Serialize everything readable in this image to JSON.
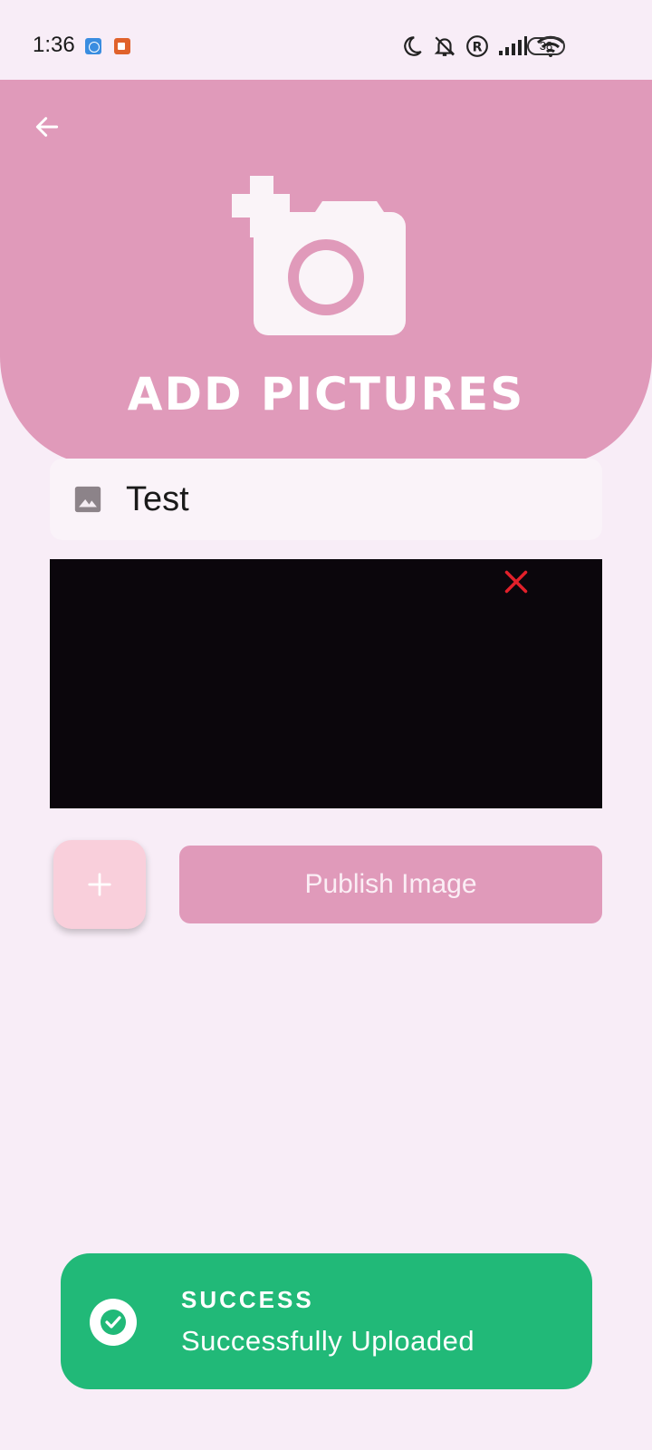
{
  "status_bar": {
    "time": "1:36",
    "battery": "38"
  },
  "header": {
    "title": "ADD PICTURES"
  },
  "form": {
    "title_value": "Test"
  },
  "actions": {
    "add_label": "+",
    "publish_label": "Publish Image"
  },
  "toast": {
    "title": "SUCCESS",
    "message": "Successfully Uploaded"
  },
  "colors": {
    "header": "#e09aba",
    "background": "#f8edf7",
    "toast": "#21b978",
    "remove_icon": "#e3202a",
    "add_button": "#f9cfdb"
  },
  "icons": {
    "back": "arrow-left-icon",
    "camera": "add-camera-icon",
    "image": "image-icon",
    "remove": "close-icon",
    "success": "check-circle-icon"
  }
}
